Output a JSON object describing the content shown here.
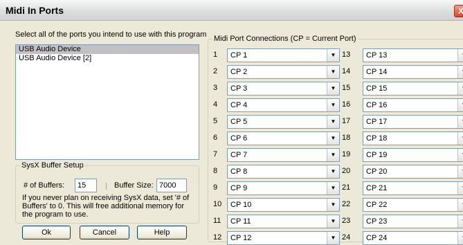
{
  "window": {
    "title": "Midi In Ports",
    "close_glyph": "X"
  },
  "ports_select": {
    "prompt": "Select all of the ports you intend to use with this program",
    "devices": [
      "USB Audio Device",
      "USB Audio Device [2]"
    ]
  },
  "sysex": {
    "legend": "SysX Buffer Setup",
    "buffers_label": "# of Buffers:",
    "buffers_value": "15",
    "size_label": "Buffer Size:",
    "size_value": "7000",
    "note": "If you never plan on receiving SysX data, set '# of Buffers' to 0. This will free additional memory for the program to use."
  },
  "buttons": {
    "ok": "Ok",
    "cancel": "Cancel",
    "help": "Help"
  },
  "connections": {
    "legend": "Midi Port Connections (CP = Current Port)",
    "left": [
      {
        "num": "1",
        "value": "CP 1"
      },
      {
        "num": "2",
        "value": "CP 2"
      },
      {
        "num": "3",
        "value": "CP 3"
      },
      {
        "num": "4",
        "value": "CP 4"
      },
      {
        "num": "5",
        "value": "CP 5"
      },
      {
        "num": "6",
        "value": "CP 6"
      },
      {
        "num": "7",
        "value": "CP 7"
      },
      {
        "num": "8",
        "value": "CP 8"
      },
      {
        "num": "9",
        "value": "CP 9"
      },
      {
        "num": "10",
        "value": "CP 10"
      },
      {
        "num": "11",
        "value": "CP 11"
      },
      {
        "num": "12",
        "value": "CP 12"
      }
    ],
    "right": [
      {
        "num": "13",
        "value": "CP 13"
      },
      {
        "num": "14",
        "value": "CP 14"
      },
      {
        "num": "15",
        "value": "CP 15"
      },
      {
        "num": "16",
        "value": "CP 16"
      },
      {
        "num": "17",
        "value": "CP 17"
      },
      {
        "num": "18",
        "value": "CP 18"
      },
      {
        "num": "19",
        "value": "CP 19"
      },
      {
        "num": "20",
        "value": "CP 20"
      },
      {
        "num": "21",
        "value": "CP 21"
      },
      {
        "num": "22",
        "value": "CP 22"
      },
      {
        "num": "23",
        "value": "CP 23"
      },
      {
        "num": "24",
        "value": "CP 24"
      }
    ]
  }
}
